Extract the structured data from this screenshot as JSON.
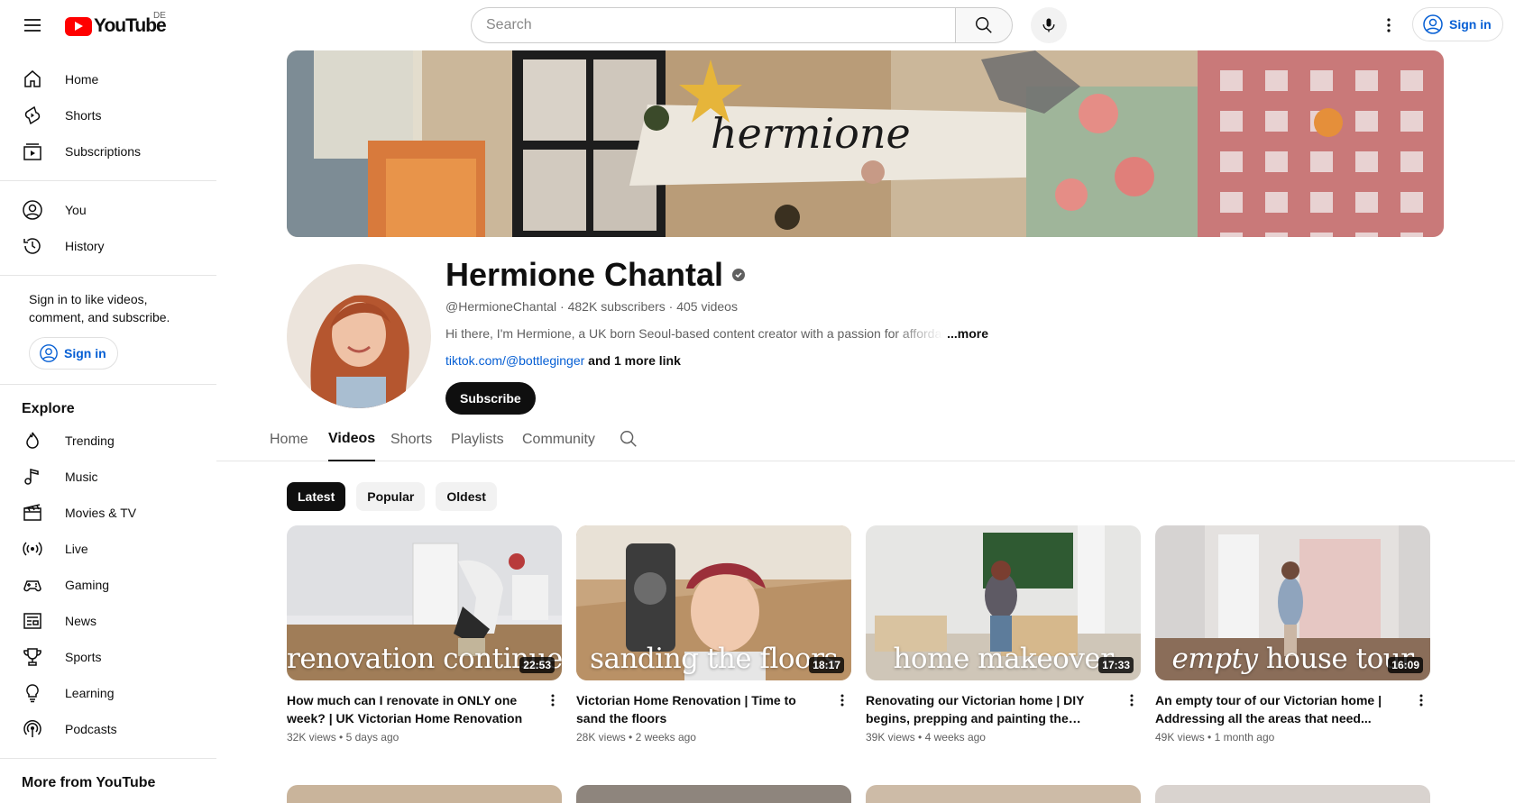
{
  "header": {
    "logo_text": "YouTube",
    "country_code": "DE",
    "search_placeholder": "Search",
    "sign_in": "Sign in"
  },
  "sidebar": {
    "main": [
      {
        "label": "Home",
        "icon": "home-icon"
      },
      {
        "label": "Shorts",
        "icon": "shorts-icon"
      },
      {
        "label": "Subscriptions",
        "icon": "subscriptions-icon"
      }
    ],
    "you": [
      {
        "label": "You",
        "icon": "user-icon"
      },
      {
        "label": "History",
        "icon": "history-icon"
      }
    ],
    "signin_prompt": "Sign in to like videos, comment, and subscribe.",
    "sign_in": "Sign in",
    "explore_title": "Explore",
    "explore": [
      {
        "label": "Trending",
        "icon": "trending-icon"
      },
      {
        "label": "Music",
        "icon": "music-icon"
      },
      {
        "label": "Movies & TV",
        "icon": "movies-icon"
      },
      {
        "label": "Live",
        "icon": "live-icon"
      },
      {
        "label": "Gaming",
        "icon": "gaming-icon"
      },
      {
        "label": "News",
        "icon": "news-icon"
      },
      {
        "label": "Sports",
        "icon": "sports-icon"
      },
      {
        "label": "Learning",
        "icon": "learning-icon"
      },
      {
        "label": "Podcasts",
        "icon": "podcasts-icon"
      }
    ],
    "more_title": "More from YouTube"
  },
  "channel": {
    "banner_text": "hermione",
    "name": "Hermione Chantal",
    "handle": "@HermioneChantal",
    "subscribers": "482K subscribers",
    "video_count": "405 videos",
    "description": "Hi there, I'm Hermione, a UK born Seoul-based content creator with a passion for affordable",
    "more": "...more",
    "link": "tiktok.com/@bottleginger",
    "more_links": "and 1 more link",
    "subscribe": "Subscribe"
  },
  "tabs": [
    {
      "label": "Home",
      "active": false
    },
    {
      "label": "Videos",
      "active": true
    },
    {
      "label": "Shorts",
      "active": false
    },
    {
      "label": "Playlists",
      "active": false
    },
    {
      "label": "Community",
      "active": false
    }
  ],
  "chips": [
    {
      "label": "Latest",
      "active": true
    },
    {
      "label": "Popular",
      "active": false
    },
    {
      "label": "Oldest",
      "active": false
    }
  ],
  "videos": [
    {
      "thumb_text": "renovation continues",
      "duration": "22:53",
      "title": "How much can I renovate in ONLY one week? | UK Victorian Home Renovation",
      "views": "32K views",
      "age": "5 days ago"
    },
    {
      "thumb_text": "sanding the floors",
      "duration": "18:17",
      "title": "Victorian Home Renovation | Time to sand the floors",
      "views": "28K views",
      "age": "2 weeks ago"
    },
    {
      "thumb_text": "home makeover",
      "duration": "17:33",
      "title": "Renovating our Victorian home | DIY begins, prepping and painting the kitchen",
      "views": "39K views",
      "age": "4 weeks ago"
    },
    {
      "thumb_text_italic": "empty",
      "thumb_text": "house tour",
      "duration": "16:09",
      "title": "An empty tour of our Victorian home | Addressing all the areas that need...",
      "views": "49K views",
      "age": "1 month ago"
    }
  ],
  "colors": {
    "brand_red": "#ff0000",
    "link_blue": "#065fd4",
    "text_primary": "#0f0f0f",
    "text_secondary": "#606060"
  }
}
